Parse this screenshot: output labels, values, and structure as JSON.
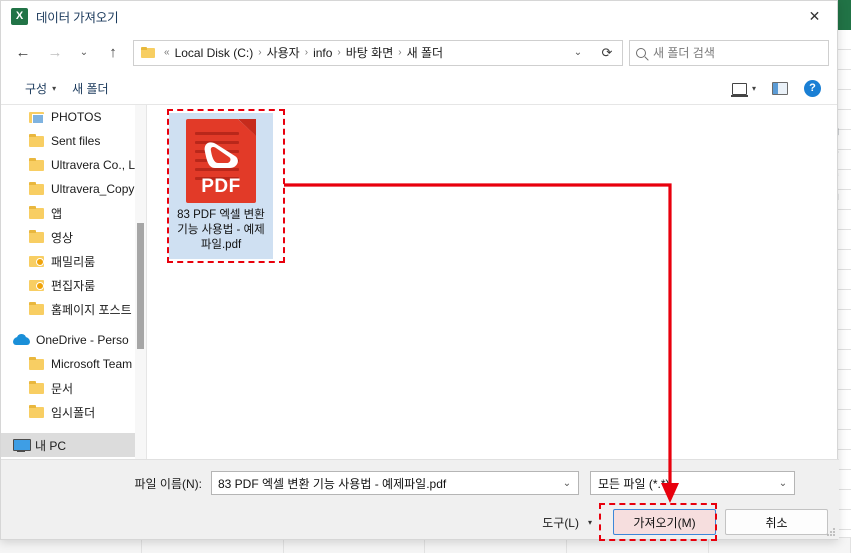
{
  "window": {
    "title": "데이터 가져오기",
    "app_icon": "excel-icon",
    "close_label": "✕",
    "accent_green": "#217346",
    "annotation_color": "#e8000d"
  },
  "nav": {
    "back": "←",
    "forward": "→",
    "recent": "⌄",
    "up": "↑",
    "refresh": "⟳",
    "address_chevron": "⌄"
  },
  "address": {
    "prefix": "«",
    "crumbs": [
      "Local Disk (C:)",
      "사용자",
      "info",
      "바탕 화면",
      "새 폴더"
    ],
    "separator": "›"
  },
  "search": {
    "placeholder": "새 폴더 검색",
    "icon": "search-icon"
  },
  "toolbar": {
    "organize_label": "구성",
    "organize_caret": "▾",
    "new_folder_label": "새 폴더",
    "view_caret": "▾",
    "help_glyph": "?"
  },
  "sidebar": {
    "items": [
      {
        "label": "PHOTOS",
        "icon": "photos-folder-icon",
        "level": 1,
        "selected": false
      },
      {
        "label": "Sent files",
        "icon": "folder-icon",
        "level": 1,
        "selected": false
      },
      {
        "label": "Ultravera Co., Lt",
        "icon": "folder-icon",
        "level": 1,
        "selected": false
      },
      {
        "label": "Ultravera_Copy",
        "icon": "folder-icon",
        "level": 1,
        "selected": false
      },
      {
        "label": "앱",
        "icon": "folder-icon",
        "level": 1,
        "selected": false
      },
      {
        "label": "영상",
        "icon": "folder-icon",
        "level": 1,
        "selected": false
      },
      {
        "label": "패밀리룸",
        "icon": "shared-folder-icon",
        "level": 1,
        "selected": false
      },
      {
        "label": "편집자룸",
        "icon": "shared-folder-icon",
        "level": 1,
        "selected": false
      },
      {
        "label": "홈페이지 포스트",
        "icon": "folder-icon",
        "level": 1,
        "selected": false
      },
      {
        "label": "OneDrive - Perso",
        "icon": "cloud-icon",
        "level": 0,
        "selected": false
      },
      {
        "label": "Microsoft Team",
        "icon": "folder-icon",
        "level": 1,
        "selected": false
      },
      {
        "label": "문서",
        "icon": "folder-icon",
        "level": 1,
        "selected": false
      },
      {
        "label": "임시폴더",
        "icon": "folder-icon",
        "level": 1,
        "selected": false
      },
      {
        "label": "내 PC",
        "icon": "pc-icon",
        "level": 0,
        "selected": true
      }
    ]
  },
  "files": [
    {
      "name": "83 PDF 엑셀 변환 기능 사용법 - 예제파일.pdf",
      "type": "pdf",
      "icon_label": "PDF",
      "selected": true,
      "annotated": true
    }
  ],
  "footer": {
    "filename_label": "파일 이름(N):",
    "filename_value": "83 PDF 엑셀 변환 기능 사용법 - 예제파일.pdf",
    "filetype_value": "모든 파일 (*.*)",
    "dropdown_chevron": "⌄",
    "tools_label": "도구(L)",
    "tools_caret": "▾",
    "import_label": "가져오기(M)",
    "cancel_label": "취소"
  }
}
